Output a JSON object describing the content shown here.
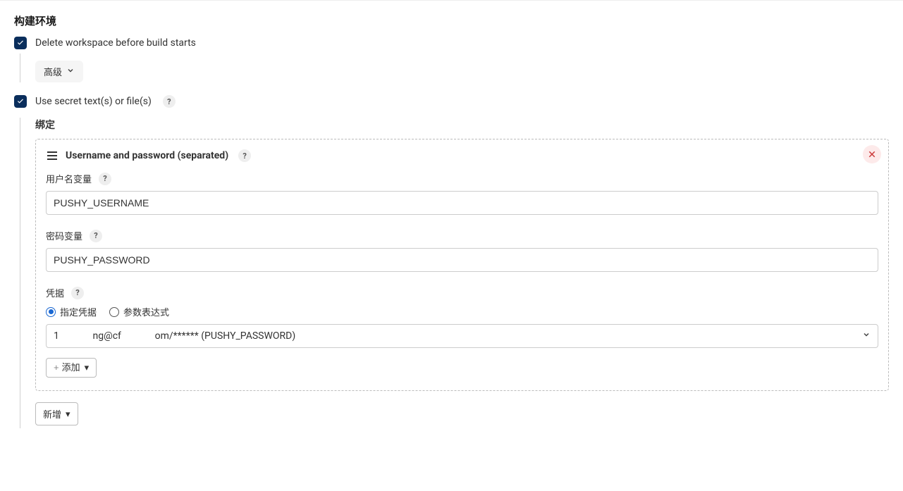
{
  "section": {
    "title": "构建环境"
  },
  "options": {
    "delete_workspace": {
      "label": "Delete workspace before build starts",
      "advanced_label": "高级"
    },
    "use_secret": {
      "label": "Use secret text(s) or file(s)"
    }
  },
  "binding": {
    "title": "绑定",
    "panel_title": "Username and password (separated)",
    "username_var_label": "用户名变量",
    "username_var_value": "PUSHY_USERNAME",
    "password_var_label": "密码变量",
    "password_var_value": "PUSHY_PASSWORD",
    "credentials_label": "凭据",
    "radio_specific": "指定凭据",
    "radio_param": "参数表达式",
    "credential_value_prefix": "1",
    "credential_value_mid": "ng@cf",
    "credential_value_suffix": "om/****** (PUSHY_PASSWORD)",
    "add_button": "添加",
    "new_button": "新增"
  }
}
